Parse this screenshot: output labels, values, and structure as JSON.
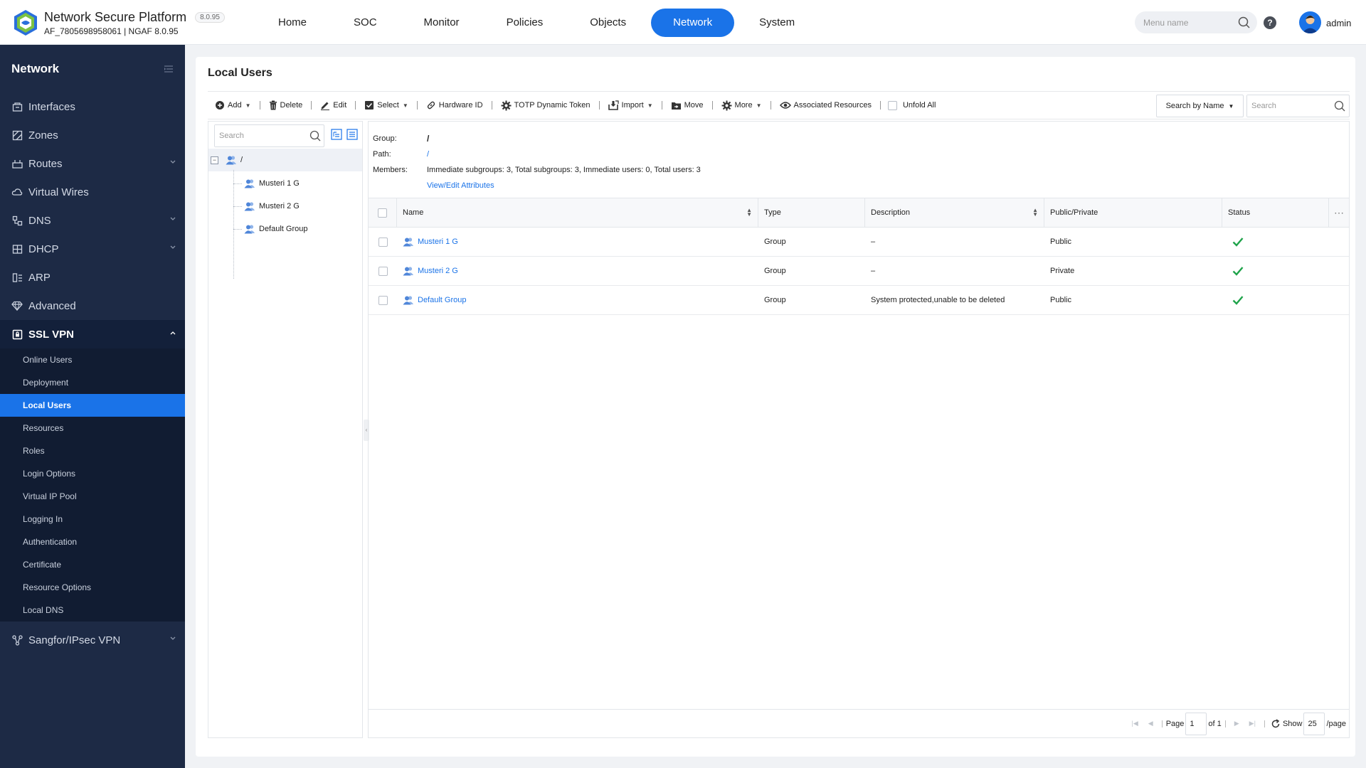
{
  "brand": {
    "title": "Network Secure Platform",
    "version": "8.0.95",
    "subtitle": "AF_7805698958061 | NGAF 8.0.95"
  },
  "nav": [
    "Home",
    "SOC",
    "Monitor",
    "Policies",
    "Objects",
    "Network",
    "System"
  ],
  "nav_active": "Network",
  "header": {
    "menu_search_placeholder": "Menu name",
    "user": "admin"
  },
  "sidebar": {
    "title": "Network",
    "items": [
      {
        "label": "Interfaces",
        "icon": "interfaces-icon"
      },
      {
        "label": "Zones",
        "icon": "zones-icon"
      },
      {
        "label": "Routes",
        "icon": "routes-icon",
        "expandable": true
      },
      {
        "label": "Virtual Wires",
        "icon": "cloud-icon"
      },
      {
        "label": "DNS",
        "icon": "dns-icon",
        "expandable": true
      },
      {
        "label": "DHCP",
        "icon": "dhcp-icon",
        "expandable": true
      },
      {
        "label": "ARP",
        "icon": "arp-icon"
      },
      {
        "label": "Advanced",
        "icon": "diamond-icon"
      },
      {
        "label": "SSL VPN",
        "icon": "ssl-vpn-icon",
        "open": true
      }
    ],
    "ssl_sub": [
      "Online Users",
      "Deployment",
      "Local Users",
      "Resources",
      "Roles",
      "Login Options",
      "Virtual IP Pool",
      "Logging In",
      "Authentication",
      "Certificate",
      "Resource Options",
      "Local DNS"
    ],
    "ssl_active": "Local Users",
    "after": {
      "label": "Sangfor/IPsec VPN",
      "icon": "ipsec-icon"
    }
  },
  "page": {
    "title": "Local Users"
  },
  "toolbar": {
    "add": "Add",
    "delete": "Delete",
    "edit": "Edit",
    "select": "Select",
    "hardware_id": "Hardware ID",
    "totp": "TOTP Dynamic Token",
    "import": "Import",
    "move": "Move",
    "more": "More",
    "associated": "Associated Resources",
    "unfold_all": "Unfold All",
    "search_by": "Search by Name",
    "search_placeholder": "Search"
  },
  "tree": {
    "search_placeholder": "Search",
    "root": "/",
    "children": [
      "Musteri 1 G",
      "Musteri 2 G",
      "Default Group"
    ]
  },
  "info": {
    "group_label": "Group:",
    "group_value": "/",
    "path_label": "Path:",
    "path_value": "/",
    "members_label": "Members:",
    "members_value": "Immediate subgroups: 3, Total subgroups: 3, Immediate users: 0, Total users: 3",
    "attr_link": "View/Edit Attributes"
  },
  "table": {
    "columns": [
      "Name",
      "Type",
      "Description",
      "Public/Private",
      "Status"
    ],
    "rows": [
      {
        "name": "Musteri 1 G",
        "type": "Group",
        "description": "–",
        "visibility": "Public",
        "status": "enabled"
      },
      {
        "name": "Musteri 2 G",
        "type": "Group",
        "description": "–",
        "visibility": "Private",
        "status": "enabled"
      },
      {
        "name": "Default Group",
        "type": "Group",
        "description": "System protected,unable to be deleted",
        "visibility": "Public",
        "status": "enabled"
      }
    ]
  },
  "pager": {
    "page_label": "Page",
    "page": "1",
    "of": "of 1",
    "show": "Show",
    "per_page": "25",
    "per_page_suffix": "/page"
  },
  "colors": {
    "accent": "#1a73e8",
    "sidebar_bg": "#1d2a45",
    "ok_green": "#1fa34a"
  }
}
